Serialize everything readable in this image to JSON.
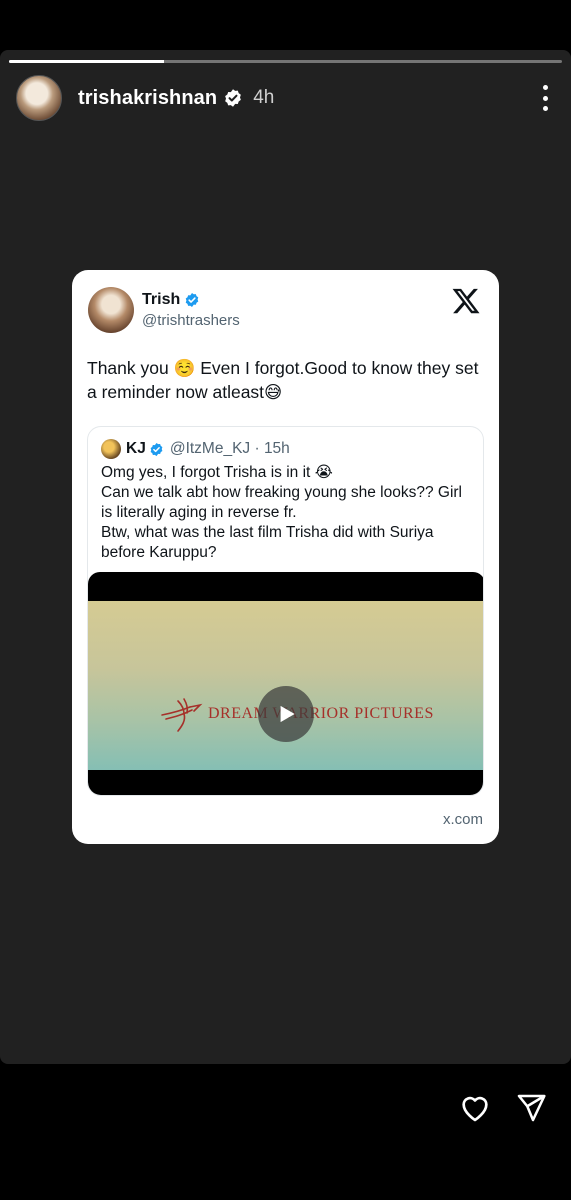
{
  "story": {
    "progress_fraction": 0.28,
    "username": "trishakrishnan",
    "time": "4h",
    "icons": [
      "verified-icon",
      "more-vertical-icon",
      "heart-icon",
      "send-icon"
    ]
  },
  "tweet": {
    "name": "Trish",
    "handle": "@trishtrashers",
    "text": "Thank you ☺️ Even I forgot.Good to know they set a reminder now atleast😅",
    "logo": "x-logo-icon",
    "source": "x.com",
    "quote": {
      "name": "KJ",
      "handle_time": "@ItzMe_KJ · 15h",
      "lines": [
        "Omg yes, I forgot Trisha is in it 😭",
        "Can we talk abt how freaking young she looks?? Girl is literally aging in reverse fr.",
        "Btw, what was the last film Trisha did with Suriya before Karuppu?"
      ],
      "video": {
        "brand_text": "DREAM WARRIOR PICTURES",
        "icon": "play-icon"
      }
    }
  },
  "colors": {
    "story_bg": "#212121",
    "verified_blue": "#1d9bf0",
    "brand_red": "#a6302a"
  }
}
